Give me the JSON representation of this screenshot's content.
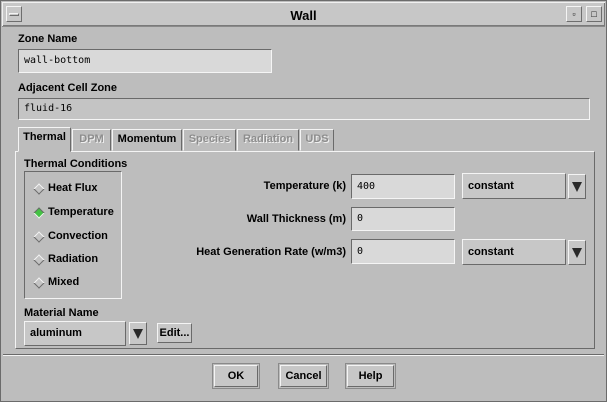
{
  "window": {
    "title": "Wall"
  },
  "zone_name": {
    "label": "Zone Name",
    "value": "wall-bottom"
  },
  "adjacent_cell_zone": {
    "label": "Adjacent Cell Zone",
    "value": "fluid-16"
  },
  "tabs": [
    {
      "label": "Thermal",
      "state": "active"
    },
    {
      "label": "DPM",
      "state": "disabled"
    },
    {
      "label": "Momentum",
      "state": "enabled"
    },
    {
      "label": "Species",
      "state": "disabled"
    },
    {
      "label": "Radiation",
      "state": "disabled"
    },
    {
      "label": "UDS",
      "state": "disabled"
    }
  ],
  "thermal": {
    "conditions_label": "Thermal Conditions",
    "options": [
      {
        "label": "Heat Flux",
        "selected": false
      },
      {
        "label": "Temperature",
        "selected": true
      },
      {
        "label": "Convection",
        "selected": false
      },
      {
        "label": "Radiation",
        "selected": false
      },
      {
        "label": "Mixed",
        "selected": false
      }
    ],
    "temperature": {
      "label": "Temperature (k)",
      "value": "400",
      "method": "constant"
    },
    "wall_thickness": {
      "label": "Wall Thickness (m)",
      "value": "0"
    },
    "heat_generation": {
      "label": "Heat Generation Rate (w/m3)",
      "value": "0",
      "method": "constant"
    },
    "material": {
      "label": "Material Name",
      "value": "aluminum",
      "edit_label": "Edit..."
    }
  },
  "buttons": {
    "ok": "OK",
    "cancel": "Cancel",
    "help": "Help"
  },
  "colors": {
    "background": "#bdbdbd",
    "radio_selected": "#44c244",
    "field": "#d9d9d9"
  },
  "icons": {
    "window_menu": "window-menu-icon",
    "minimize": "minimize-icon",
    "maximize": "maximize-icon",
    "dropdown": "dropdown-arrow-icon"
  }
}
